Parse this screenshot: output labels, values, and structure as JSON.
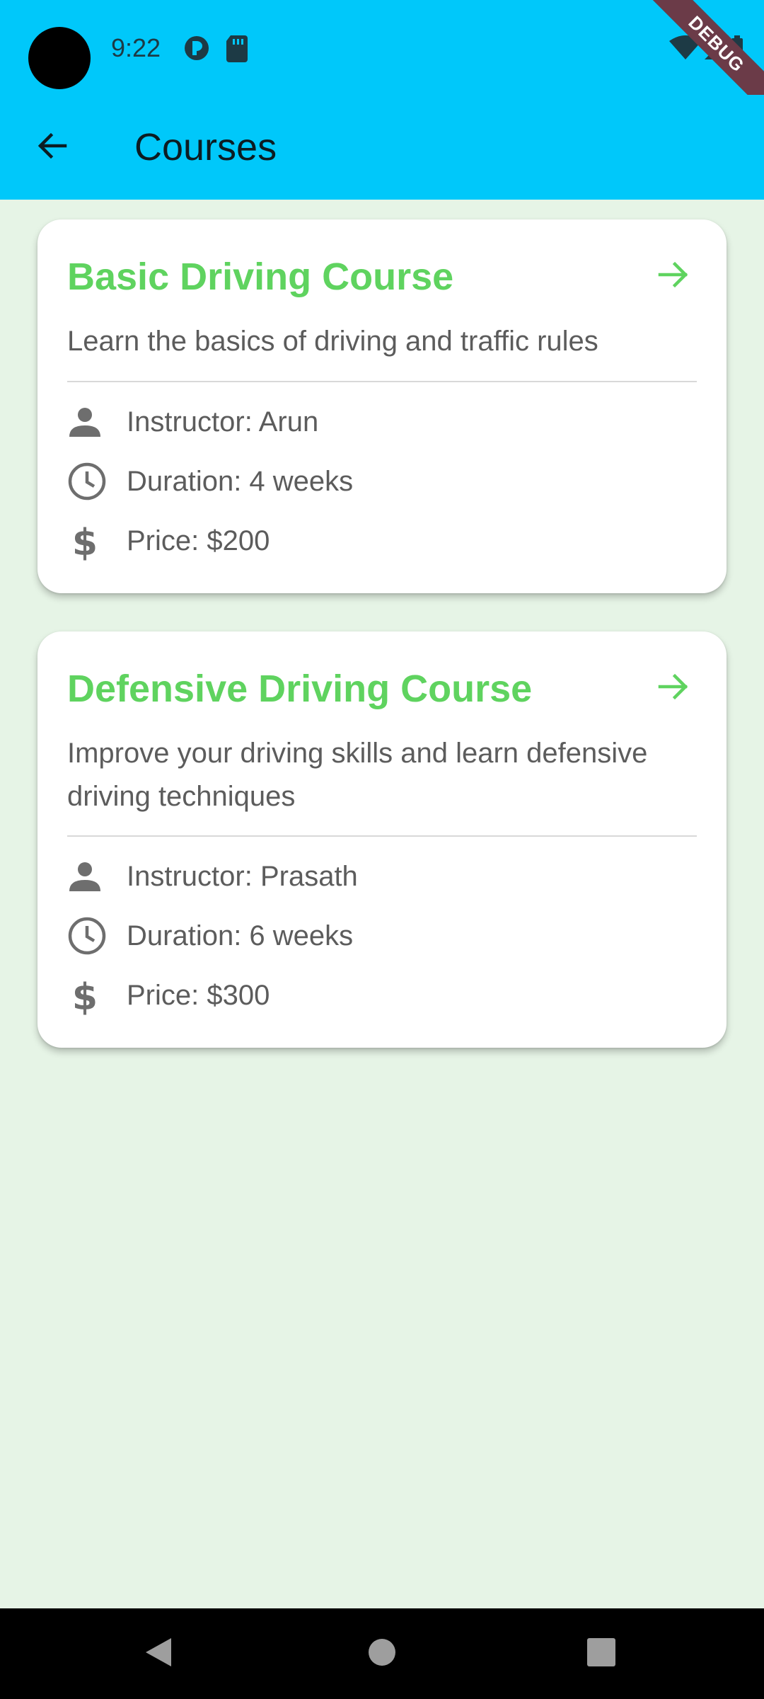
{
  "status_bar": {
    "time": "9:22"
  },
  "debug_banner": "DEBUG",
  "app_bar": {
    "title": "Courses"
  },
  "courses": [
    {
      "title": "Basic Driving Course",
      "description": "Learn the basics of driving and traffic rules",
      "instructor": "Instructor: Arun",
      "duration": "Duration: 4 weeks",
      "price": "Price: $200"
    },
    {
      "title": "Defensive Driving Course",
      "description": "Improve your driving skills and learn defensive driving techniques",
      "instructor": "Instructor: Prasath",
      "duration": "Duration: 6 weeks",
      "price": "Price: $300"
    }
  ],
  "icons": {
    "back": "arrow-back-icon",
    "open": "arrow-forward-icon",
    "instructor": "person-icon",
    "duration": "clock-icon",
    "price": "dollar-icon"
  },
  "colors": {
    "app_bar": "#00c8fa",
    "background": "#e6f4e6",
    "accent": "#5fd35f",
    "text_secondary": "#5c5c5c"
  }
}
